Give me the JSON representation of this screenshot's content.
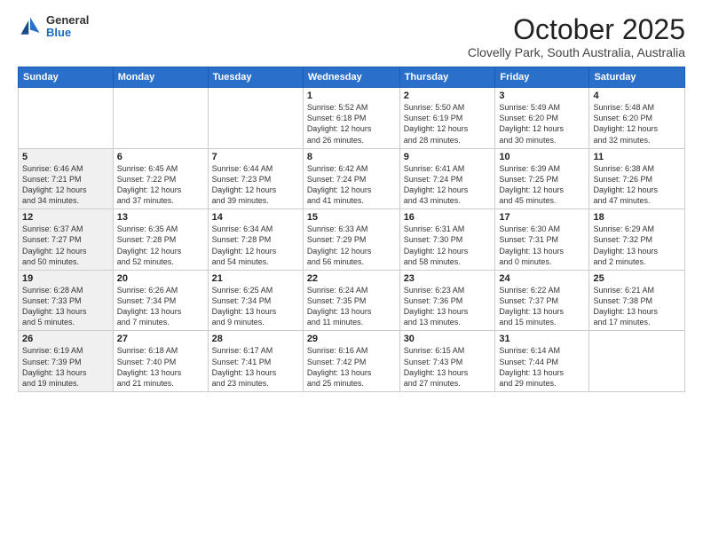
{
  "header": {
    "logo_general": "General",
    "logo_blue": "Blue",
    "month": "October 2025",
    "location": "Clovelly Park, South Australia, Australia"
  },
  "days_of_week": [
    "Sunday",
    "Monday",
    "Tuesday",
    "Wednesday",
    "Thursday",
    "Friday",
    "Saturday"
  ],
  "weeks": [
    [
      {
        "day": "",
        "content": "",
        "shaded": true
      },
      {
        "day": "",
        "content": "",
        "shaded": true
      },
      {
        "day": "",
        "content": "",
        "shaded": true
      },
      {
        "day": "1",
        "content": "Sunrise: 5:52 AM\nSunset: 6:18 PM\nDaylight: 12 hours\nand 26 minutes.",
        "shaded": false
      },
      {
        "day": "2",
        "content": "Sunrise: 5:50 AM\nSunset: 6:19 PM\nDaylight: 12 hours\nand 28 minutes.",
        "shaded": false
      },
      {
        "day": "3",
        "content": "Sunrise: 5:49 AM\nSunset: 6:20 PM\nDaylight: 12 hours\nand 30 minutes.",
        "shaded": false
      },
      {
        "day": "4",
        "content": "Sunrise: 5:48 AM\nSunset: 6:20 PM\nDaylight: 12 hours\nand 32 minutes.",
        "shaded": false
      }
    ],
    [
      {
        "day": "5",
        "content": "Sunrise: 6:46 AM\nSunset: 7:21 PM\nDaylight: 12 hours\nand 34 minutes.",
        "shaded": true
      },
      {
        "day": "6",
        "content": "Sunrise: 6:45 AM\nSunset: 7:22 PM\nDaylight: 12 hours\nand 37 minutes.",
        "shaded": false
      },
      {
        "day": "7",
        "content": "Sunrise: 6:44 AM\nSunset: 7:23 PM\nDaylight: 12 hours\nand 39 minutes.",
        "shaded": false
      },
      {
        "day": "8",
        "content": "Sunrise: 6:42 AM\nSunset: 7:24 PM\nDaylight: 12 hours\nand 41 minutes.",
        "shaded": false
      },
      {
        "day": "9",
        "content": "Sunrise: 6:41 AM\nSunset: 7:24 PM\nDaylight: 12 hours\nand 43 minutes.",
        "shaded": false
      },
      {
        "day": "10",
        "content": "Sunrise: 6:39 AM\nSunset: 7:25 PM\nDaylight: 12 hours\nand 45 minutes.",
        "shaded": false
      },
      {
        "day": "11",
        "content": "Sunrise: 6:38 AM\nSunset: 7:26 PM\nDaylight: 12 hours\nand 47 minutes.",
        "shaded": false
      }
    ],
    [
      {
        "day": "12",
        "content": "Sunrise: 6:37 AM\nSunset: 7:27 PM\nDaylight: 12 hours\nand 50 minutes.",
        "shaded": true
      },
      {
        "day": "13",
        "content": "Sunrise: 6:35 AM\nSunset: 7:28 PM\nDaylight: 12 hours\nand 52 minutes.",
        "shaded": false
      },
      {
        "day": "14",
        "content": "Sunrise: 6:34 AM\nSunset: 7:28 PM\nDaylight: 12 hours\nand 54 minutes.",
        "shaded": false
      },
      {
        "day": "15",
        "content": "Sunrise: 6:33 AM\nSunset: 7:29 PM\nDaylight: 12 hours\nand 56 minutes.",
        "shaded": false
      },
      {
        "day": "16",
        "content": "Sunrise: 6:31 AM\nSunset: 7:30 PM\nDaylight: 12 hours\nand 58 minutes.",
        "shaded": false
      },
      {
        "day": "17",
        "content": "Sunrise: 6:30 AM\nSunset: 7:31 PM\nDaylight: 13 hours\nand 0 minutes.",
        "shaded": false
      },
      {
        "day": "18",
        "content": "Sunrise: 6:29 AM\nSunset: 7:32 PM\nDaylight: 13 hours\nand 2 minutes.",
        "shaded": false
      }
    ],
    [
      {
        "day": "19",
        "content": "Sunrise: 6:28 AM\nSunset: 7:33 PM\nDaylight: 13 hours\nand 5 minutes.",
        "shaded": true
      },
      {
        "day": "20",
        "content": "Sunrise: 6:26 AM\nSunset: 7:34 PM\nDaylight: 13 hours\nand 7 minutes.",
        "shaded": false
      },
      {
        "day": "21",
        "content": "Sunrise: 6:25 AM\nSunset: 7:34 PM\nDaylight: 13 hours\nand 9 minutes.",
        "shaded": false
      },
      {
        "day": "22",
        "content": "Sunrise: 6:24 AM\nSunset: 7:35 PM\nDaylight: 13 hours\nand 11 minutes.",
        "shaded": false
      },
      {
        "day": "23",
        "content": "Sunrise: 6:23 AM\nSunset: 7:36 PM\nDaylight: 13 hours\nand 13 minutes.",
        "shaded": false
      },
      {
        "day": "24",
        "content": "Sunrise: 6:22 AM\nSunset: 7:37 PM\nDaylight: 13 hours\nand 15 minutes.",
        "shaded": false
      },
      {
        "day": "25",
        "content": "Sunrise: 6:21 AM\nSunset: 7:38 PM\nDaylight: 13 hours\nand 17 minutes.",
        "shaded": false
      }
    ],
    [
      {
        "day": "26",
        "content": "Sunrise: 6:19 AM\nSunset: 7:39 PM\nDaylight: 13 hours\nand 19 minutes.",
        "shaded": true
      },
      {
        "day": "27",
        "content": "Sunrise: 6:18 AM\nSunset: 7:40 PM\nDaylight: 13 hours\nand 21 minutes.",
        "shaded": false
      },
      {
        "day": "28",
        "content": "Sunrise: 6:17 AM\nSunset: 7:41 PM\nDaylight: 13 hours\nand 23 minutes.",
        "shaded": false
      },
      {
        "day": "29",
        "content": "Sunrise: 6:16 AM\nSunset: 7:42 PM\nDaylight: 13 hours\nand 25 minutes.",
        "shaded": false
      },
      {
        "day": "30",
        "content": "Sunrise: 6:15 AM\nSunset: 7:43 PM\nDaylight: 13 hours\nand 27 minutes.",
        "shaded": false
      },
      {
        "day": "31",
        "content": "Sunrise: 6:14 AM\nSunset: 7:44 PM\nDaylight: 13 hours\nand 29 minutes.",
        "shaded": false
      },
      {
        "day": "",
        "content": "",
        "shaded": false
      }
    ]
  ]
}
